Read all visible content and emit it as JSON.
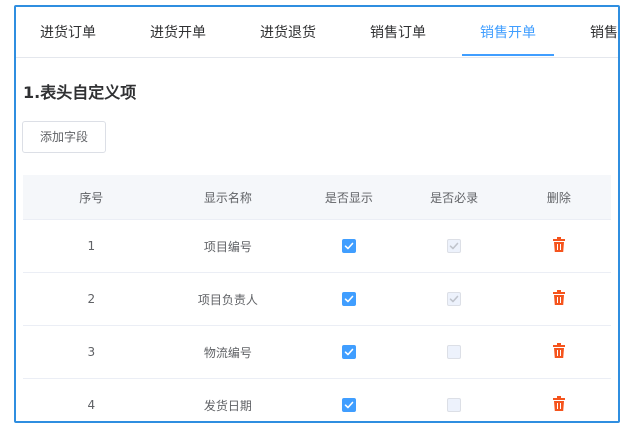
{
  "tabs": [
    {
      "label": "进货订单"
    },
    {
      "label": "进货开单"
    },
    {
      "label": "进货退货"
    },
    {
      "label": "销售订单"
    },
    {
      "label": "销售开单"
    },
    {
      "label": "销售排"
    }
  ],
  "active_tab_index": 4,
  "section": {
    "title": "1.表头自定义项",
    "add_button_label": "添加字段"
  },
  "table": {
    "headers": [
      "序号",
      "显示名称",
      "是否显示",
      "是否必录",
      "删除"
    ],
    "rows": [
      {
        "index": "1",
        "name": "项目编号",
        "show": true,
        "required": true
      },
      {
        "index": "2",
        "name": "项目负责人",
        "show": true,
        "required": true
      },
      {
        "index": "3",
        "name": "物流编号",
        "show": true,
        "required": false
      },
      {
        "index": "4",
        "name": "发货日期",
        "show": true,
        "required": false
      }
    ]
  },
  "icons": {
    "delete": "trash-icon",
    "checked": "check-icon"
  },
  "colors": {
    "accent": "#409eff",
    "frame": "#2f8ee0",
    "delete": "#f5541d"
  }
}
